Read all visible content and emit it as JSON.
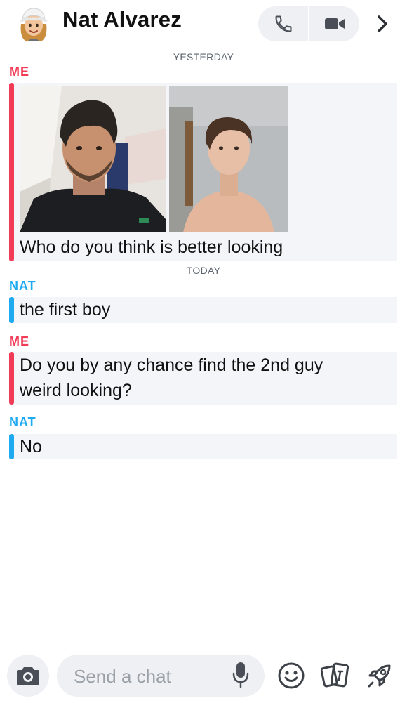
{
  "header": {
    "contact_name": "Nat Alvarez",
    "icons": [
      "bitmoji-avatar",
      "phone-icon",
      "video-icon",
      "chevron-right-icon"
    ]
  },
  "conversation": {
    "separators": {
      "yesterday": "YESTERDAY",
      "today": "TODAY"
    },
    "messages": [
      {
        "sender": "ME",
        "text": "Who do you think is better looking",
        "attachments": [
          "photo-1",
          "photo-2"
        ]
      },
      {
        "sender": "NAT",
        "text": "the first boy"
      },
      {
        "sender": "ME",
        "text_line1": "Do you by any chance find the 2nd guy",
        "text_line2": "weird looking?"
      },
      {
        "sender": "NAT",
        "text": "No"
      }
    ]
  },
  "composer": {
    "placeholder": "Send a chat",
    "icons": [
      "camera-icon",
      "microphone-icon",
      "smiley-icon",
      "cards-icon",
      "rocket-icon"
    ]
  },
  "colors": {
    "me": "#f23c57",
    "nat": "#1eaaf1",
    "bubble": "#f4f5f8",
    "control": "#eef0f3"
  }
}
